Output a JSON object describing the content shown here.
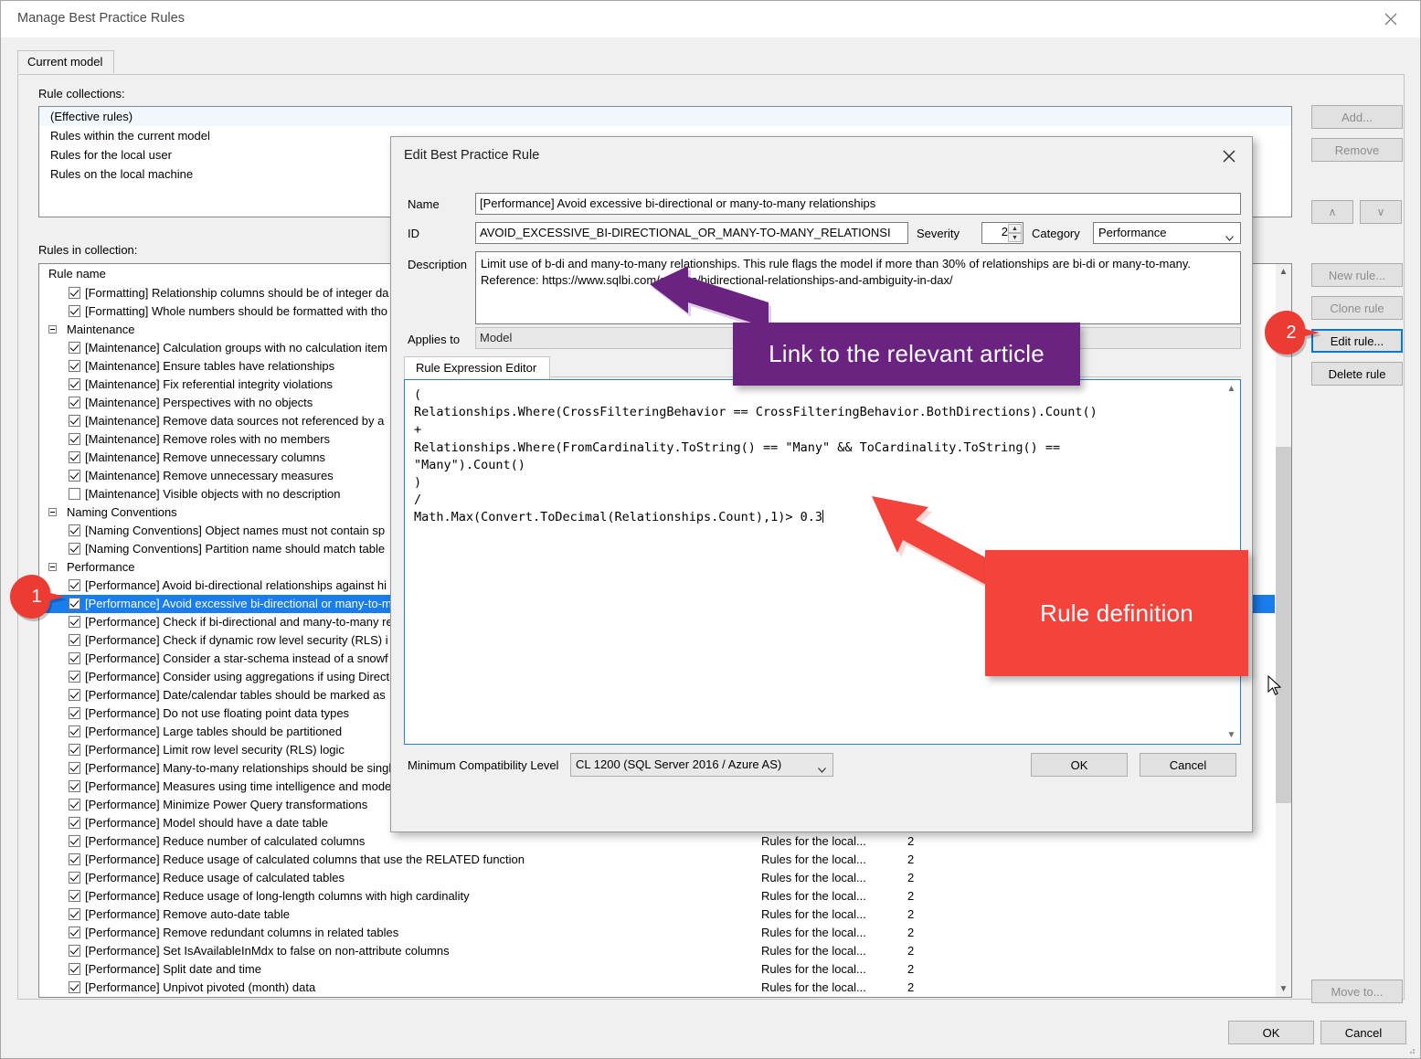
{
  "window": {
    "title": "Manage Best Practice Rules",
    "close_icon": "close-icon"
  },
  "tabs": [
    {
      "label": "Current model",
      "active": true
    }
  ],
  "labels": {
    "rule_collections": "Rule collections:",
    "rules_in_collection": "Rules in collection:",
    "rule_name_header": "Rule name"
  },
  "collections": [
    {
      "label": "(Effective rules)",
      "selected": true
    },
    {
      "label": "Rules within the current model",
      "selected": false
    },
    {
      "label": "Rules for the local user",
      "selected": false
    },
    {
      "label": "Rules on the local machine",
      "selected": false
    }
  ],
  "collection_buttons": {
    "add": "Add...",
    "remove": "Remove",
    "move_up": "∧",
    "move_down": "∨"
  },
  "rule_buttons": {
    "new_rule": "New rule...",
    "clone_rule": "Clone rule",
    "edit_rule": "Edit rule...",
    "delete_rule": "Delete rule",
    "move_to": "Move to..."
  },
  "dialog_buttons": {
    "ok": "OK",
    "cancel": "Cancel"
  },
  "rules": [
    {
      "type": "rule",
      "checked": true,
      "label": "[Formatting] Relationship columns should be of integer da",
      "source": "",
      "severity": ""
    },
    {
      "type": "rule",
      "checked": true,
      "label": "[Formatting] Whole numbers should be formatted with tho",
      "source": "",
      "severity": ""
    },
    {
      "type": "group",
      "label": "Maintenance"
    },
    {
      "type": "rule",
      "checked": true,
      "label": "[Maintenance] Calculation groups with no calculation item",
      "source": "",
      "severity": ""
    },
    {
      "type": "rule",
      "checked": true,
      "label": "[Maintenance] Ensure tables have relationships",
      "source": "",
      "severity": ""
    },
    {
      "type": "rule",
      "checked": true,
      "label": "[Maintenance] Fix referential integrity violations",
      "source": "",
      "severity": ""
    },
    {
      "type": "rule",
      "checked": true,
      "label": "[Maintenance] Perspectives with no objects",
      "source": "",
      "severity": ""
    },
    {
      "type": "rule",
      "checked": true,
      "label": "[Maintenance] Remove data sources not referenced by a",
      "source": "",
      "severity": ""
    },
    {
      "type": "rule",
      "checked": true,
      "label": "[Maintenance] Remove roles with no members",
      "source": "",
      "severity": ""
    },
    {
      "type": "rule",
      "checked": true,
      "label": "[Maintenance] Remove unnecessary columns",
      "source": "",
      "severity": ""
    },
    {
      "type": "rule",
      "checked": true,
      "label": "[Maintenance] Remove unnecessary measures",
      "source": "",
      "severity": ""
    },
    {
      "type": "rule",
      "checked": false,
      "label": "[Maintenance] Visible objects with no description",
      "source": "",
      "severity": ""
    },
    {
      "type": "group",
      "label": "Naming Conventions"
    },
    {
      "type": "rule",
      "checked": true,
      "label": "[Naming Conventions] Object names must not contain sp",
      "source": "",
      "severity": ""
    },
    {
      "type": "rule",
      "checked": true,
      "label": "[Naming Conventions] Partition name should match table",
      "source": "",
      "severity": ""
    },
    {
      "type": "group",
      "label": "Performance"
    },
    {
      "type": "rule",
      "checked": true,
      "label": "[Performance] Avoid bi-directional relationships against hi",
      "source": "",
      "severity": ""
    },
    {
      "type": "rule",
      "checked": true,
      "selected": true,
      "label": "[Performance] Avoid excessive bi-directional or many-to-m",
      "source": "",
      "severity": ""
    },
    {
      "type": "rule",
      "checked": true,
      "label": "[Performance] Check if bi-directional and many-to-many re",
      "source": "",
      "severity": ""
    },
    {
      "type": "rule",
      "checked": true,
      "label": "[Performance] Check if dynamic row level security (RLS) i",
      "source": "",
      "severity": ""
    },
    {
      "type": "rule",
      "checked": true,
      "label": "[Performance] Consider a star-schema instead of a snowf",
      "source": "",
      "severity": ""
    },
    {
      "type": "rule",
      "checked": true,
      "label": "[Performance] Consider using aggregations if using Direct",
      "source": "",
      "severity": ""
    },
    {
      "type": "rule",
      "checked": true,
      "label": "[Performance] Date/calendar tables should be marked as",
      "source": "",
      "severity": ""
    },
    {
      "type": "rule",
      "checked": true,
      "label": "[Performance] Do not use floating point data types",
      "source": "",
      "severity": ""
    },
    {
      "type": "rule",
      "checked": true,
      "label": "[Performance] Large tables should be partitioned",
      "source": "",
      "severity": ""
    },
    {
      "type": "rule",
      "checked": true,
      "label": "[Performance] Limit row level security (RLS) logic",
      "source": "",
      "severity": ""
    },
    {
      "type": "rule",
      "checked": true,
      "label": "[Performance] Many-to-many relationships should be singl",
      "source": "",
      "severity": ""
    },
    {
      "type": "rule",
      "checked": true,
      "label": "[Performance] Measures using time intelligence and mode",
      "source": "",
      "severity": ""
    },
    {
      "type": "rule",
      "checked": true,
      "label": "[Performance] Minimize Power Query transformations",
      "source": "",
      "severity": ""
    },
    {
      "type": "rule",
      "checked": true,
      "label": "[Performance] Model should have a date table",
      "source": "",
      "severity": ""
    },
    {
      "type": "rule",
      "checked": true,
      "label": "[Performance] Reduce number of calculated columns",
      "source": "Rules for the local...",
      "severity": "2"
    },
    {
      "type": "rule",
      "checked": true,
      "label": "[Performance] Reduce usage of calculated columns that use the RELATED function",
      "source": "Rules for the local...",
      "severity": "2"
    },
    {
      "type": "rule",
      "checked": true,
      "label": "[Performance] Reduce usage of calculated tables",
      "source": "Rules for the local...",
      "severity": "2"
    },
    {
      "type": "rule",
      "checked": true,
      "label": "[Performance] Reduce usage of long-length columns with high cardinality",
      "source": "Rules for the local...",
      "severity": "2"
    },
    {
      "type": "rule",
      "checked": true,
      "label": "[Performance] Remove auto-date table",
      "source": "Rules for the local...",
      "severity": "2"
    },
    {
      "type": "rule",
      "checked": true,
      "label": "[Performance] Remove redundant columns in related tables",
      "source": "Rules for the local...",
      "severity": "2"
    },
    {
      "type": "rule",
      "checked": true,
      "label": "[Performance] Set IsAvailableInMdx to false on non-attribute columns",
      "source": "Rules for the local...",
      "severity": "2"
    },
    {
      "type": "rule",
      "checked": true,
      "label": "[Performance] Split date and time",
      "source": "Rules for the local...",
      "severity": "2"
    },
    {
      "type": "rule",
      "checked": true,
      "label": "[Performance] Unpivot pivoted (month) data",
      "source": "Rules for the local...",
      "severity": "2"
    }
  ],
  "dialog": {
    "title": "Edit Best Practice Rule",
    "close_icon": "close-icon",
    "fields": {
      "name_label": "Name",
      "name_value": "[Performance] Avoid excessive bi-directional or many-to-many relationships",
      "id_label": "ID",
      "id_value": "AVOID_EXCESSIVE_BI-DIRECTIONAL_OR_MANY-TO-MANY_RELATIONSI",
      "severity_label": "Severity",
      "severity_value": "2",
      "category_label": "Category",
      "category_value": "Performance",
      "description_label": "Description",
      "description_value": "Limit use of b-di and many-to-many relationships. This rule flags the model if more than 30% of relationships are bi-di or many-to-many.\nReference: https://www.sqlbi.com/articles/bidirectional-relationships-and-ambiguity-in-dax/",
      "applies_to_label": "Applies to",
      "applies_to_value": "Model",
      "min_compat_label": "Minimum Compatibility Level",
      "min_compat_value": "CL 1200 (SQL Server 2016 / Azure AS)"
    },
    "expression_tab": "Rule Expression Editor",
    "expression": "(\nRelationships.Where(CrossFilteringBehavior == CrossFilteringBehavior.BothDirections).Count()\n+\nRelationships.Where(FromCardinality.ToString() == \"Many\" && ToCardinality.ToString() ==\n\"Many\").Count()\n)\n/\nMath.Max(Convert.ToDecimal(Relationships.Count),1)> 0.3",
    "ok": "OK",
    "cancel": "Cancel"
  },
  "annotations": {
    "callout_purple": "Link to the relevant article",
    "callout_red": "Rule definition",
    "badge_one": "1",
    "badge_two": "2",
    "purple_color": "#6b2382",
    "red_color": "#f4433b",
    "selection_color": "#1a7ded"
  }
}
